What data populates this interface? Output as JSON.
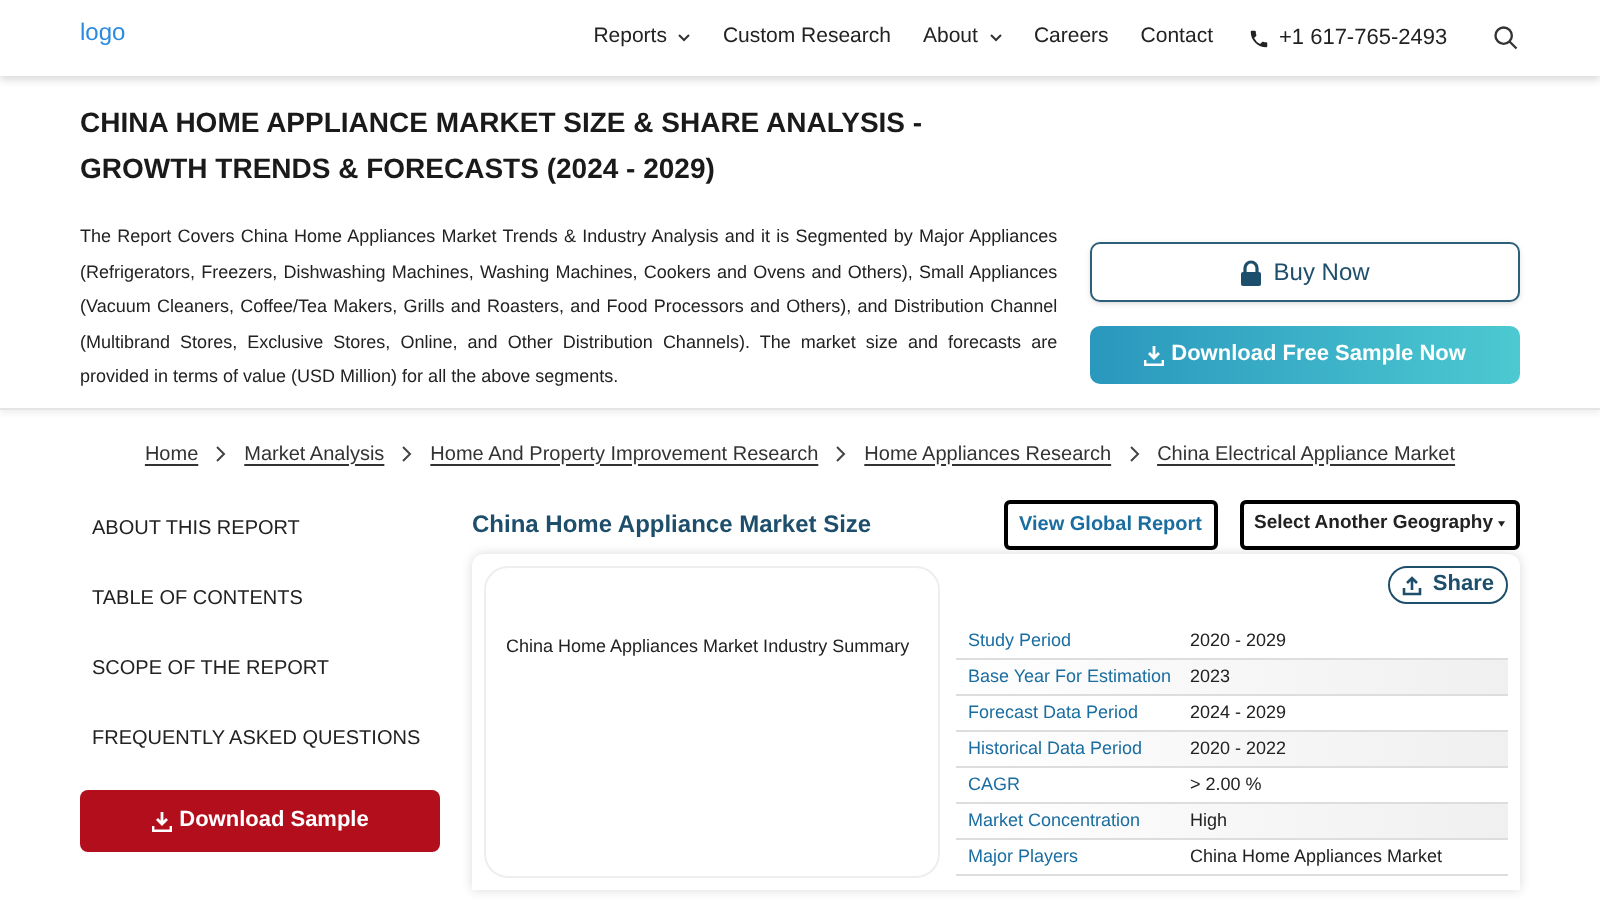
{
  "header": {
    "logo": "logo",
    "nav": [
      {
        "label": "Reports",
        "dropdown": true
      },
      {
        "label": "Custom Research",
        "dropdown": false
      },
      {
        "label": "About",
        "dropdown": true
      },
      {
        "label": "Careers",
        "dropdown": false
      },
      {
        "label": "Contact",
        "dropdown": false
      }
    ],
    "phone": "+1 617-765-2493"
  },
  "hero": {
    "title": "CHINA HOME APPLIANCE MARKET SIZE & SHARE ANALYSIS - GROWTH TRENDS & FORECASTS (2024 - 2029)",
    "description": "The Report Covers China Home Appliances Market Trends & Industry Analysis and it is Segmented by Major Appliances (Refrigerators, Freezers, Dishwashing Machines, Washing Machines, Cookers and Ovens and Others), Small Appliances (Vacuum Cleaners, Coffee/Tea Makers, Grills and Roasters, and Food Processors and Others), and Distribution Channel (Multibrand Stores, Exclusive Stores, Online, and Other Distribution Channels). The market size and forecasts are provided in terms of value (USD Million) for all the above segments.",
    "buy_button": "Buy Now",
    "sample_button": "Download Free Sample Now"
  },
  "breadcrumb": [
    "Home",
    "Market Analysis",
    "Home And Property Improvement Research",
    "Home Appliances Research",
    "China Electrical Appliance Market"
  ],
  "sidebar": {
    "items": [
      "ABOUT THIS REPORT",
      "TABLE OF CONTENTS",
      "SCOPE OF THE REPORT",
      "FREQUENTLY ASKED QUESTIONS"
    ],
    "download_button": "Download Sample"
  },
  "main": {
    "heading": "China Home Appliance Market Size",
    "global_button": "View Global Report",
    "geography_select": "Select Another Geography",
    "share_button": "Share",
    "image_alt": "China Home Appliances Market Industry Summary",
    "summary": [
      {
        "label": "Study Period",
        "value": "2020 - 2029"
      },
      {
        "label": "Base Year For Estimation",
        "value": "2023"
      },
      {
        "label": "Forecast Data Period",
        "value": "2024 - 2029"
      },
      {
        "label": "Historical Data Period",
        "value": "2020 - 2022"
      },
      {
        "label": "CAGR",
        "value": "> 2.00 %"
      },
      {
        "label": "Market Concentration",
        "value": "High"
      },
      {
        "label": "Major Players",
        "value": "China Home Appliances Market"
      }
    ]
  }
}
